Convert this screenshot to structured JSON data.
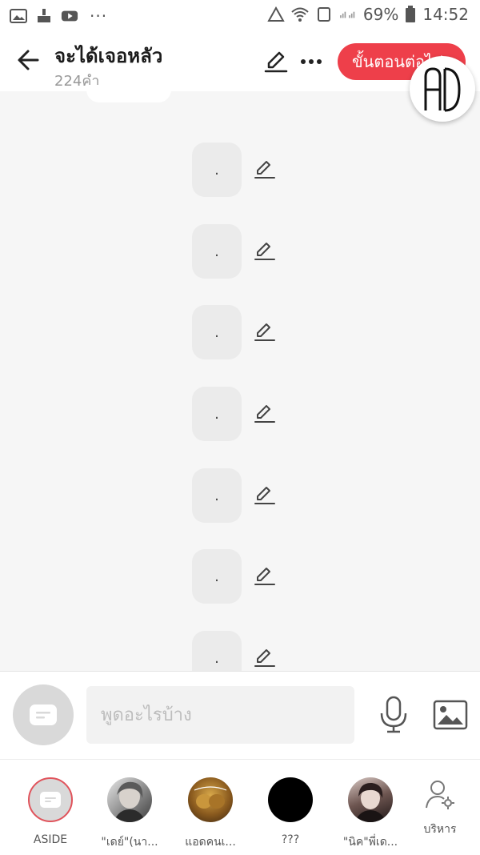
{
  "status_bar": {
    "battery": "69%",
    "time": "14:52",
    "more": "···"
  },
  "header": {
    "title": "จะได้เจอหลัว",
    "subtitle": "224คำ",
    "next_button": "ขั้นตอนต่อไป",
    "logo_text": "AD"
  },
  "messages": [
    {
      "text": "."
    },
    {
      "text": "."
    },
    {
      "text": "."
    },
    {
      "text": "."
    },
    {
      "text": "."
    },
    {
      "text": "."
    },
    {
      "text": "."
    }
  ],
  "composer": {
    "placeholder": "พูดอะไรบ้าง"
  },
  "characters": [
    {
      "name": "ASIDE"
    },
    {
      "name": "\"เดย์\"(นา..."
    },
    {
      "name": "แอดคนเ..."
    },
    {
      "name": "???"
    },
    {
      "name": "\"นิค\"พี่เด..."
    }
  ],
  "manage": {
    "label": "บริหาร"
  },
  "colors": {
    "accent": "#ee3f4a",
    "background": "#f6f6f6",
    "bubble": "#ebebeb"
  }
}
